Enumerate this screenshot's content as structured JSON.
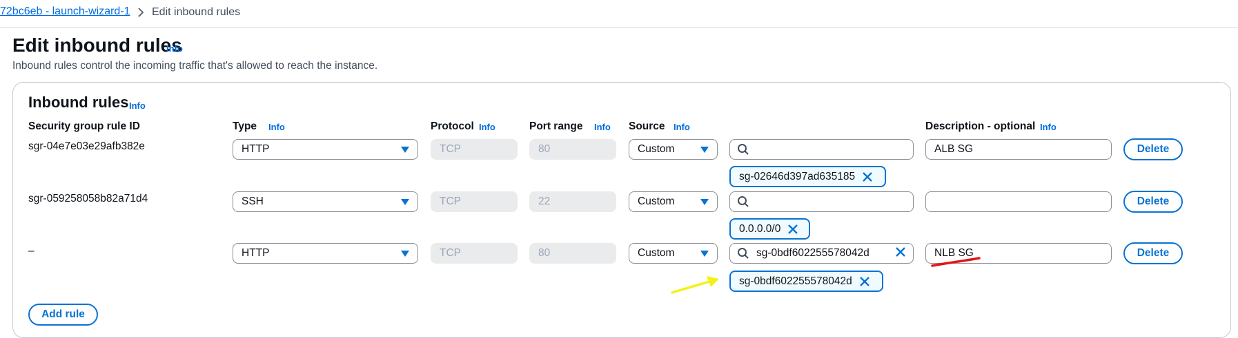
{
  "breadcrumb": {
    "parent": "72bc6eb - launch-wizard-1",
    "current": "Edit inbound rules"
  },
  "page": {
    "title": "Edit inbound rules",
    "info": "Info",
    "description": "Inbound rules control the incoming traffic that's allowed to reach the instance."
  },
  "rules_panel": {
    "title": "Inbound rules",
    "info": "Info",
    "columns": {
      "rule_id": "Security group rule ID",
      "type": "Type",
      "protocol": "Protocol",
      "port_range": "Port range",
      "source": "Source",
      "description": "Description - optional",
      "info": "Info"
    },
    "rows": [
      {
        "rule_id": "sgr-04e7e03e29afb382e",
        "type": "HTTP",
        "protocol": "TCP",
        "port": "80",
        "source_mode": "Custom",
        "search_value": "",
        "token": "sg-02646d397ad635185",
        "description": "ALB SG",
        "delete_label": "Delete"
      },
      {
        "rule_id": "sgr-059258058b82a71d4",
        "type": "SSH",
        "protocol": "TCP",
        "port": "22",
        "source_mode": "Custom",
        "search_value": "",
        "token": "0.0.0.0/0",
        "description": "",
        "delete_label": "Delete"
      },
      {
        "rule_id": "–",
        "type": "HTTP",
        "protocol": "TCP",
        "port": "80",
        "source_mode": "Custom",
        "search_value": "sg-0bdf602255578042d",
        "token": "sg-0bdf602255578042d",
        "description": "NLB SG",
        "delete_label": "Delete"
      }
    ],
    "add_rule_label": "Add rule"
  },
  "colors": {
    "link": "#006ce0",
    "accent": "#0972d3",
    "annotation_arrow": "#f2f21a",
    "annotation_underline": "#e01616"
  },
  "icons": [
    "chevron-right-icon",
    "caret-down-icon",
    "search-icon",
    "close-icon",
    "arrow-annotation",
    "underline-annotation"
  ]
}
